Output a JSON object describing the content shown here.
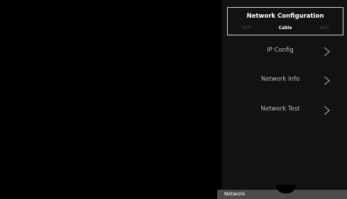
{
  "network_panel": {
    "title": "Network Configuration",
    "tabs": [
      {
        "label": "WiFi",
        "active": false
      },
      {
        "label": "Cable",
        "active": true
      },
      {
        "label": "WiFi",
        "active": false
      }
    ],
    "items": [
      {
        "label": "IP Config",
        "icon": "chevron-right-icon"
      },
      {
        "label": "Network Info",
        "icon": "chevron-right-icon"
      },
      {
        "label": "Network Test",
        "icon": "chevron-right-icon"
      }
    ]
  },
  "status_bar": {
    "label": "Network"
  },
  "colors": {
    "background": "#000000",
    "panel": "#121212",
    "header_border": "#d8d8d8",
    "text_primary": "#ffffff",
    "text_secondary": "#bfbfbf",
    "text_inactive": "#4a4a4a",
    "status_bar": "#4c4c4c"
  }
}
